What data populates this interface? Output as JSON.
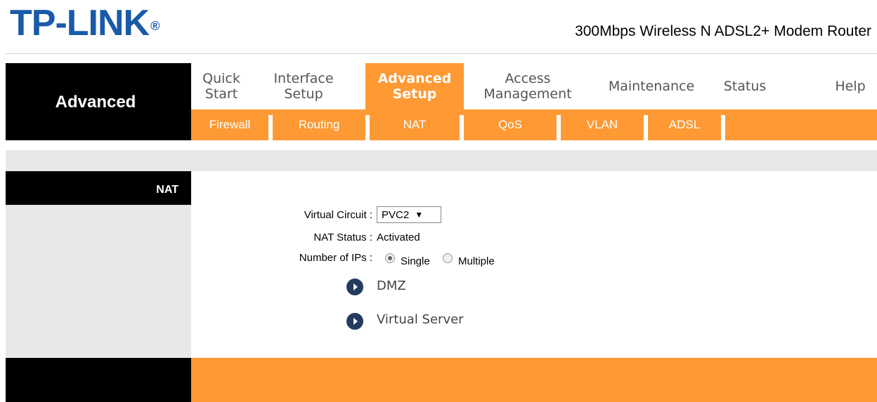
{
  "header": {
    "brand": "TP-LINK",
    "registered": "®",
    "model": "300Mbps Wireless N ADSL2+ Modem Router"
  },
  "section_title": "Advanced",
  "menu": [
    {
      "line1": "Quick",
      "line2": "Start"
    },
    {
      "line1": "Interface",
      "line2": "Setup"
    },
    {
      "line1": "Advanced",
      "line2": "Setup"
    },
    {
      "line1": "Access",
      "line2": "Management"
    },
    {
      "line1": "Maintenance",
      "line2": ""
    },
    {
      "line1": "Status",
      "line2": ""
    },
    {
      "line1": "Help",
      "line2": ""
    }
  ],
  "submenu": [
    "Firewall",
    "Routing",
    "NAT",
    "QoS",
    "VLAN",
    "ADSL"
  ],
  "left_label": "NAT",
  "form": {
    "virtual_circuit_label": "Virtual Circuit :",
    "virtual_circuit_value": "PVC2",
    "nat_status_label": "NAT Status :",
    "nat_status_value": "Activated",
    "num_ips_label": "Number of IPs :",
    "single_label": "Single",
    "multiple_label": "Multiple"
  },
  "links": {
    "dmz": "DMZ",
    "virtual_server": "Virtual Server"
  },
  "colors": {
    "brand_blue": "#1a5aa8",
    "accent_orange": "#ff9933"
  }
}
